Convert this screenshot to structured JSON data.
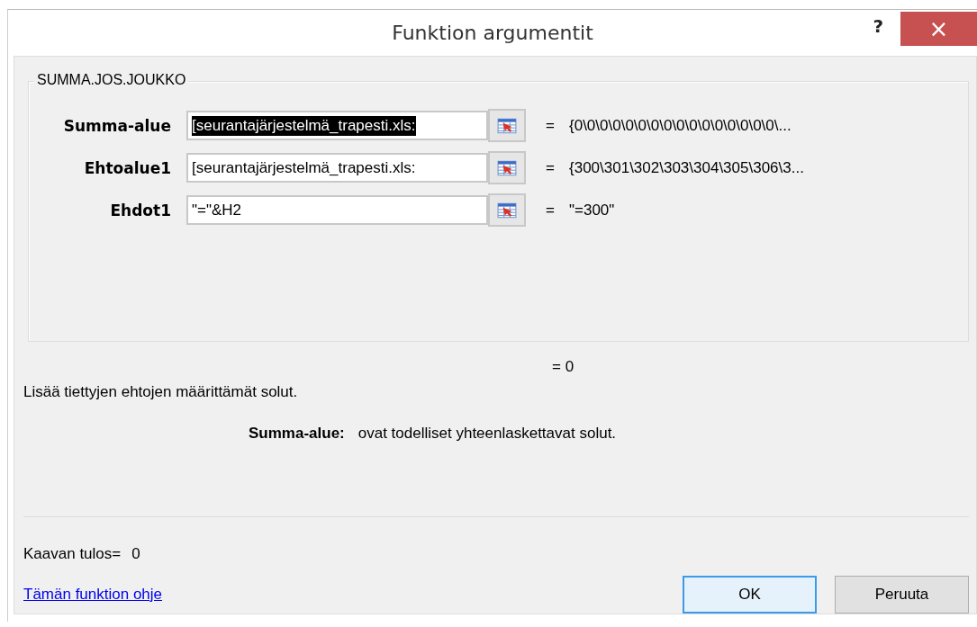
{
  "window": {
    "title": "Funktion argumentit",
    "help_button": "?",
    "close_button": "×"
  },
  "function_name": "SUMMA.JOS.JOUKKO",
  "arguments": [
    {
      "label": "Summa-alue",
      "value": "[seurantajärjestelmä_trapesti.xls:",
      "selected": true,
      "equals": "=",
      "result": "{0\\0\\0\\0\\0\\0\\0\\0\\0\\0\\0\\0\\0\\0\\0\\0\\..."
    },
    {
      "label": "Ehtoalue1",
      "value": "[seurantajärjestelmä_trapesti.xls:",
      "selected": false,
      "equals": "=",
      "result": "{300\\301\\302\\303\\304\\305\\306\\3..."
    },
    {
      "label": "Ehdot1",
      "value": "\"=\"&H2",
      "selected": false,
      "equals": "=",
      "result": "\"=300\""
    }
  ],
  "function_result": "= 0",
  "description": "Lisää tiettyjen ehtojen määrittämät solut.",
  "argument_help": {
    "name": "Summa-alue:",
    "text": "ovat todelliset yhteenlaskettavat solut."
  },
  "formula_result": {
    "label": "Kaavan tulos=",
    "value": "0"
  },
  "help_link": "Tämän funktion ohje",
  "buttons": [
    {
      "label": "OK",
      "default": true
    },
    {
      "label": "Peruuta",
      "default": false
    }
  ]
}
